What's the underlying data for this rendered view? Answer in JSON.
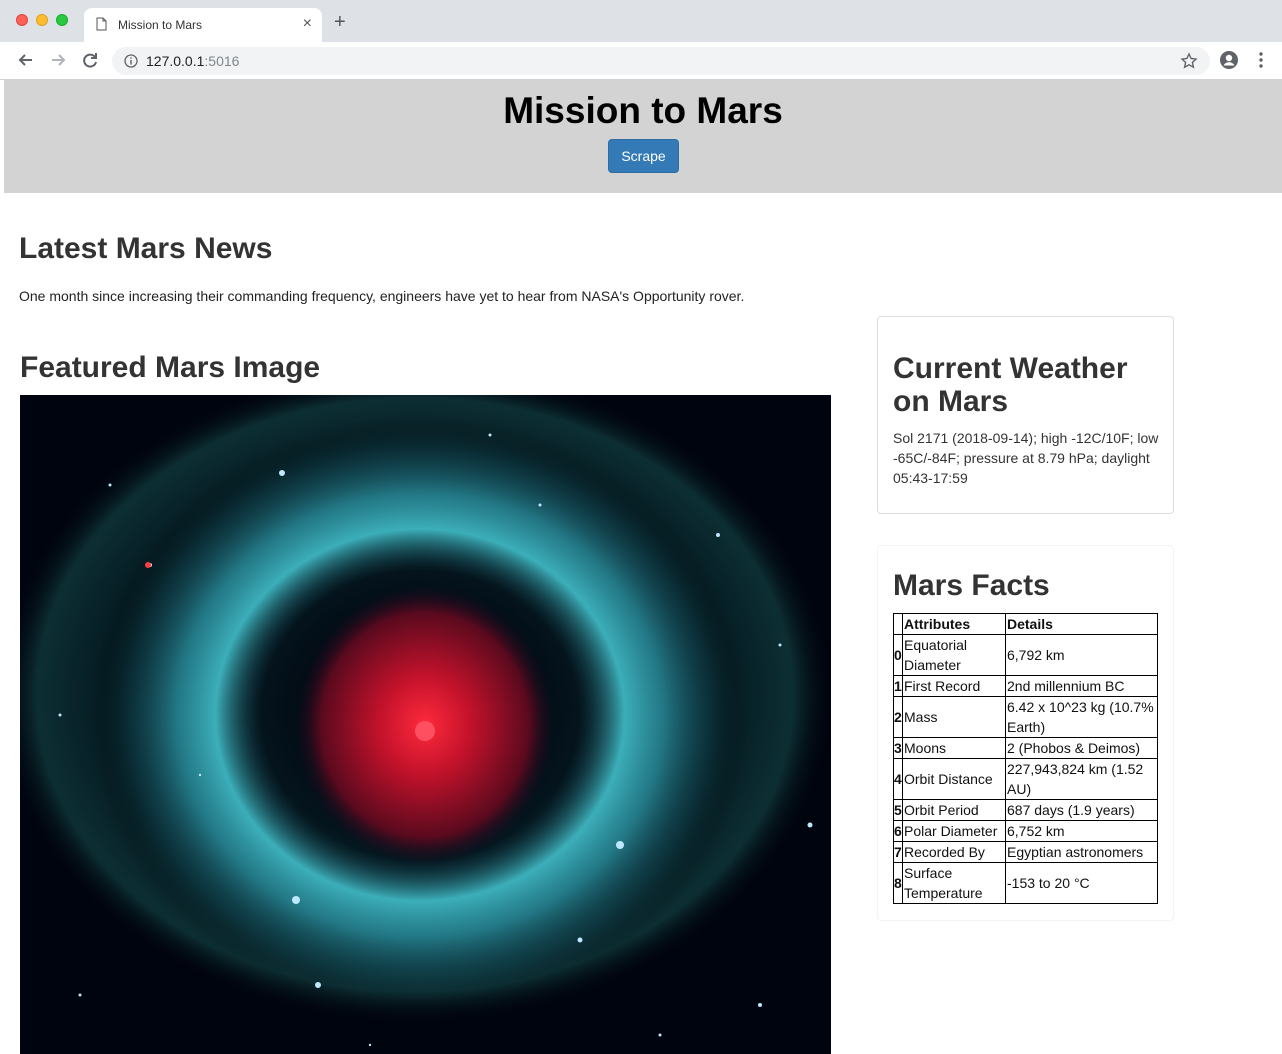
{
  "browser": {
    "tab_title": "Mission to Mars",
    "url_host": "127.0.0.1",
    "url_port": ":5016"
  },
  "header": {
    "title": "Mission to Mars",
    "scrape_button": "Scrape"
  },
  "news": {
    "heading": "Latest Mars News",
    "text": "One month since increasing their commanding frequency, engineers have yet to hear from NASA's Opportunity rover."
  },
  "featured": {
    "heading": "Featured Mars Image"
  },
  "weather": {
    "heading": "Current Weather on Mars",
    "text": "Sol 2171 (2018-09-14); high -12C/10F; low -65C/-84F; pressure at 8.79 hPa; daylight 05:43-17:59"
  },
  "facts": {
    "heading": "Mars Facts",
    "columns": [
      "Attributes",
      "Details"
    ],
    "rows": [
      {
        "idx": "0",
        "attribute": "Equatorial Diameter",
        "detail": "6,792 km"
      },
      {
        "idx": "1",
        "attribute": "First Record",
        "detail": "2nd millennium BC"
      },
      {
        "idx": "2",
        "attribute": "Mass",
        "detail": "6.42 x 10^23 kg (10.7% Earth)"
      },
      {
        "idx": "3",
        "attribute": "Moons",
        "detail": "2 (Phobos & Deimos)"
      },
      {
        "idx": "4",
        "attribute": "Orbit Distance",
        "detail": "227,943,824 km (1.52 AU)"
      },
      {
        "idx": "5",
        "attribute": "Orbit Period",
        "detail": "687 days (1.9 years)"
      },
      {
        "idx": "6",
        "attribute": "Polar Diameter",
        "detail": "6,752 km"
      },
      {
        "idx": "7",
        "attribute": "Recorded By",
        "detail": "Egyptian astronomers"
      },
      {
        "idx": "8",
        "attribute": "Surface Temperature",
        "detail": "-153 to 20 °C"
      }
    ]
  }
}
